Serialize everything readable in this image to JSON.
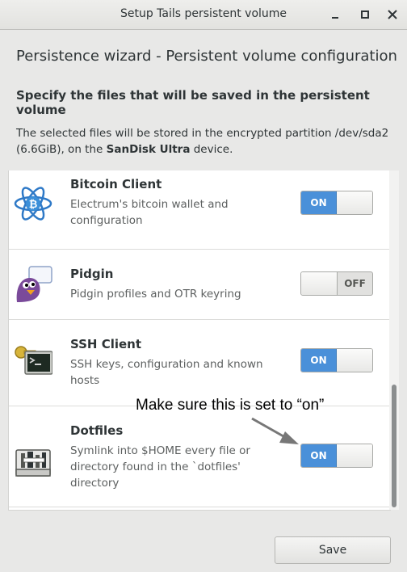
{
  "window": {
    "title": "Setup Tails persistent volume",
    "controls": [
      "minimize-icon",
      "maximize-icon",
      "close-icon"
    ]
  },
  "heading": "Persistence wizard - Persistent volume configuration",
  "subheading": "Specify the files that will be saved in the persistent volume",
  "description": {
    "line1": "The selected files will be stored in the encrypted partition /dev/sda2",
    "line2_prefix": "(6.6GiB), on the ",
    "device": "SanDisk Ultra",
    "line2_suffix": " device."
  },
  "features": [
    {
      "name": "Bitcoin Client",
      "description": "Electrum's bitcoin wallet and configuration",
      "state": "ON",
      "icon": "electrum-bitcoin-icon"
    },
    {
      "name": "Pidgin",
      "description": "Pidgin profiles and OTR keyring",
      "state": "OFF",
      "icon": "pidgin-icon"
    },
    {
      "name": "SSH Client",
      "description": "SSH keys, configuration and known hosts",
      "state": "ON",
      "icon": "ssh-key-terminal-icon"
    },
    {
      "name": "Dotfiles",
      "description": "Symlink into $HOME every file or directory found in the `dotfiles' directory",
      "state": "ON",
      "icon": "dotfiles-icon"
    }
  ],
  "annotation": "Make sure this is set to “on”",
  "save_label": "Save",
  "colors": {
    "switch_on": "#4a90d9",
    "background": "#e8e8e7",
    "list_background": "#ffffff"
  }
}
